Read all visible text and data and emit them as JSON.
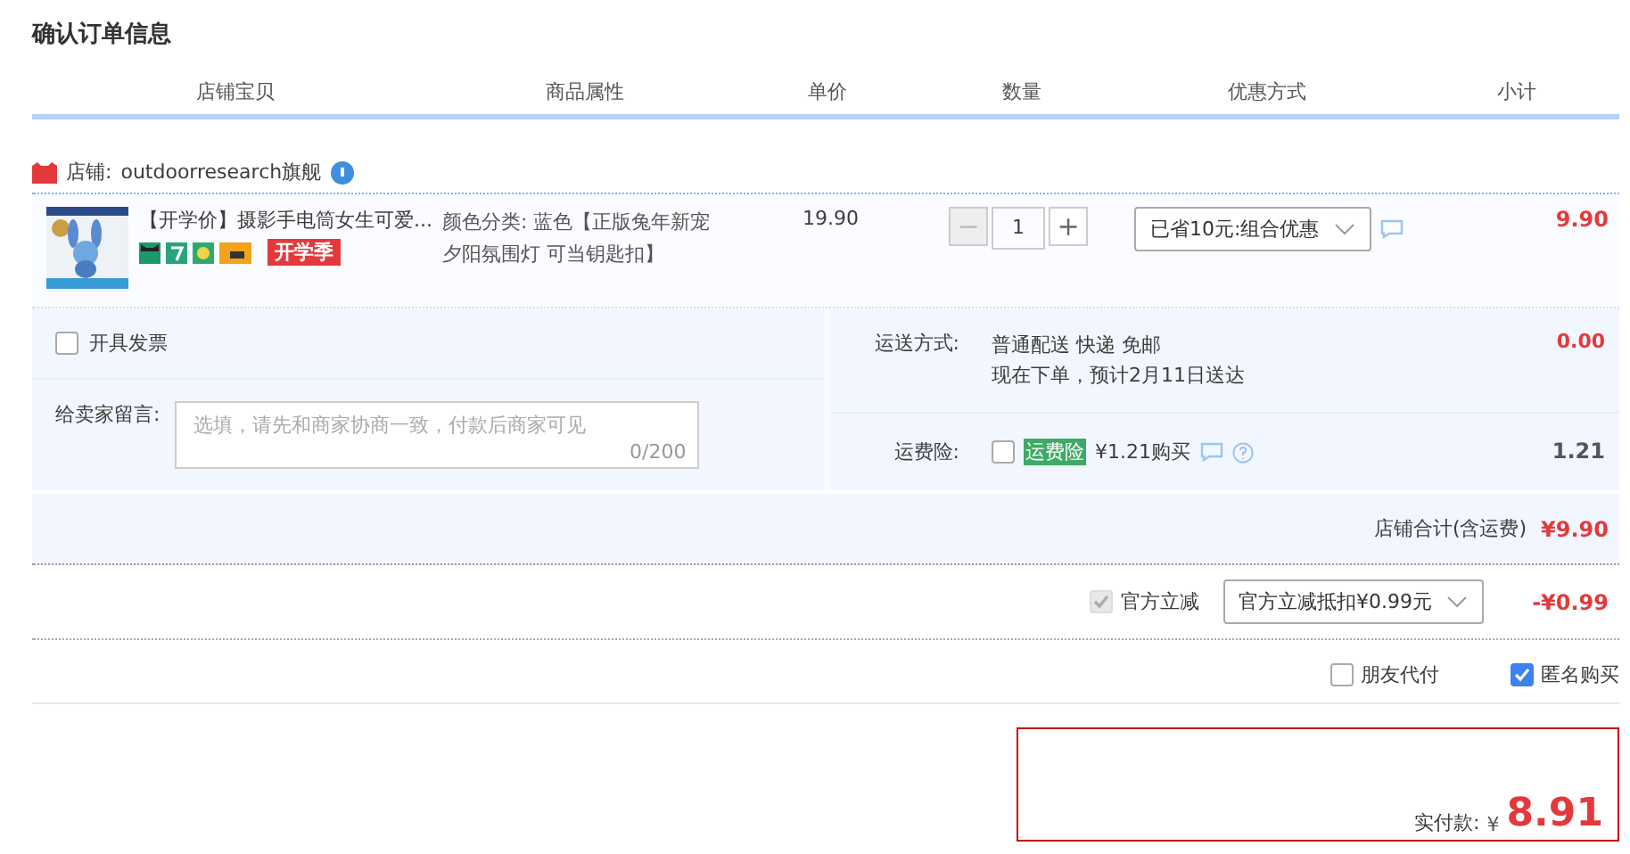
{
  "title": "确认订单信息",
  "columns": [
    "店铺宝贝",
    "商品属性",
    "单价",
    "数量",
    "优惠方式",
    "小计"
  ],
  "shop": {
    "label": "店铺:",
    "name": "outdoorresearch旗舰"
  },
  "item": {
    "title": "【开学价】摄影手电筒女生可爱...",
    "promo_tag": "开学季",
    "attributes": "颜色分类: 蓝色【正版兔年新宠夕阳氛围灯 可当钥匙扣】",
    "unit_price": "19.90",
    "minus": "−",
    "minus_disabled": true,
    "quantity": "1",
    "plus": "+",
    "discount": "已省10元:组合优惠",
    "subtotal": "9.90"
  },
  "invoice": {
    "label": "开具发票",
    "checked": false
  },
  "message": {
    "label": "给卖家留言:",
    "placeholder": "选填，请先和商家协商一致，付款后商家可见",
    "counter": "0/200"
  },
  "shipping": {
    "label": "运送方式:",
    "lines": [
      "普通配送 快递 免邮",
      "现在下单，预计2月11日送达"
    ],
    "amount": "0.00"
  },
  "insurance": {
    "label": "运费险:",
    "checked": false,
    "tag": "运费险",
    "text": "¥1.21购买",
    "amount": "1.21"
  },
  "shop_total": {
    "label": "店铺合计(含运费)",
    "amount": "¥9.90"
  },
  "official": {
    "checked": true,
    "disabled": true,
    "label": "官方立减",
    "select": "官方立减抵扣¥0.99元",
    "amount": "-¥0.99"
  },
  "options": [
    {
      "label": "朋友代付",
      "checked": false
    },
    {
      "label": "匿名购买",
      "checked": true
    }
  ],
  "pay": {
    "label": "实付款:",
    "currency": "¥",
    "amount": "8.91"
  }
}
